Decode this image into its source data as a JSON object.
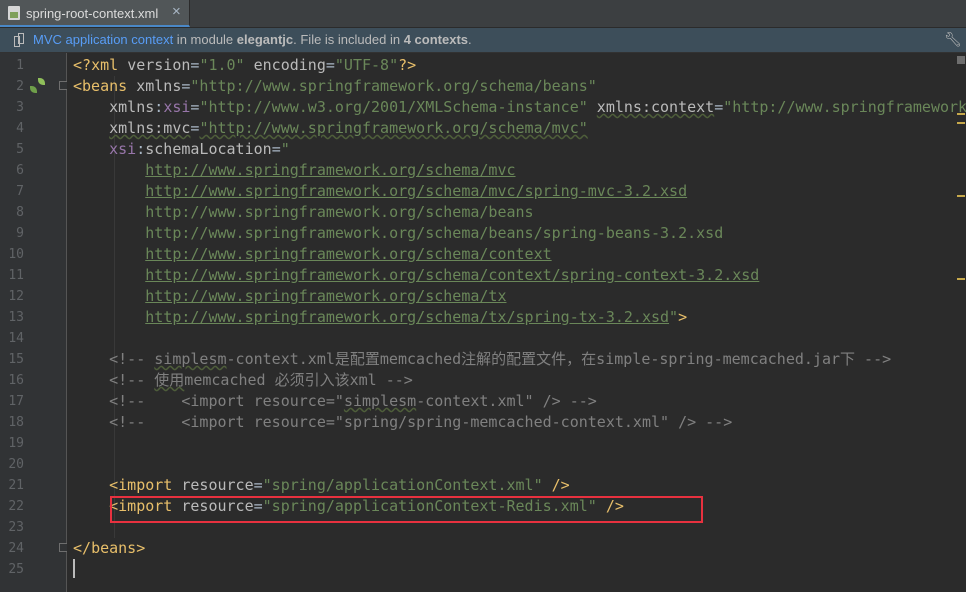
{
  "tab": {
    "filename": "spring-root-context.xml",
    "close": "×"
  },
  "infobar": {
    "link": "MVC application context",
    "t1": " in module ",
    "module": "elegantjc",
    "t2": ". File is included in ",
    "count": "4 contexts",
    "t3": "."
  },
  "line_numbers": [
    "1",
    "2",
    "3",
    "4",
    "5",
    "6",
    "7",
    "8",
    "9",
    "10",
    "11",
    "12",
    "13",
    "14",
    "15",
    "16",
    "17",
    "18",
    "19",
    "20",
    "21",
    "22",
    "23",
    "24",
    "25"
  ],
  "code": {
    "l1": {
      "a": "<?",
      "b": "xml ",
      "c": "version",
      "d": "=",
      "e": "\"1.0\"",
      "f": " ",
      "g": "encoding",
      "h": "=",
      "i": "\"UTF-8\"",
      "j": "?>"
    },
    "l2": {
      "a": "<",
      "b": "beans ",
      "c": "xmlns",
      "d": "=",
      "e": "\"http://www.springframework.org/schema/beans\""
    },
    "l3": {
      "indent": "    ",
      "a": "xmlns",
      "b": ":",
      "c": "xsi",
      "d": "=",
      "e": "\"http://www.w3.org/2001/XMLSchema-instance\"",
      "f": " ",
      "g": "xmlns:context",
      "h": "=",
      "i": "\"http://www.springframework.org/schema/context\""
    },
    "l4": {
      "indent": "    ",
      "a": "xmlns:mvc",
      "b": "=",
      "c": "\"http://www.springframework.org/schema/mvc\""
    },
    "l5": {
      "indent": "    ",
      "a": "xsi",
      "b": ":",
      "c": "schemaLocation",
      "d": "=",
      "e": "\""
    },
    "l6": {
      "indent": "        ",
      "a": "http://www.springframework.org/schema/mvc"
    },
    "l7": {
      "indent": "        ",
      "a": "http://www.springframework.org/schema/mvc/spring-mvc-3.2.xsd"
    },
    "l8": {
      "indent": "        ",
      "a": "http://www.springframework.org/schema/beans"
    },
    "l9": {
      "indent": "        ",
      "a": "http://www.springframework.org/schema/beans/spring-beans-3.2.xsd"
    },
    "l10": {
      "indent": "        ",
      "a": "http://www.springframework.org/schema/context"
    },
    "l11": {
      "indent": "        ",
      "a": "http://www.springframework.org/schema/context/spring-context-3.2.xsd"
    },
    "l12": {
      "indent": "        ",
      "a": "http://www.springframework.org/schema/tx"
    },
    "l13": {
      "indent": "        ",
      "a": "http://www.springframework.org/schema/tx/spring-tx-3.2.xsd",
      "b": "\"",
      "c": ">"
    },
    "l15": {
      "indent": "    ",
      "a": "<!-- ",
      "b": "simplesm",
      "c": "-context.xml是配置memcached注解的配置文件，在simple-spring-memcached.jar下 -->"
    },
    "l16": {
      "indent": "    ",
      "a": "<!-- ",
      "b": "使用",
      "c": "memcached 必须引入该xml -->"
    },
    "l17": {
      "indent": "    ",
      "a": "<!--    <import resource=\"",
      "b": "simplesm",
      "c": "-context.xml\" /> -->"
    },
    "l18": {
      "indent": "    ",
      "a": "<!--    <import resource=\"spring/spring-memcached-context.xml\" /> -->"
    },
    "l21": {
      "indent": "    ",
      "a": "<",
      "b": "import ",
      "c": "resource",
      "d": "=",
      "e": "\"spring/applicationContext.xml\"",
      "f": " ",
      "g": "/>"
    },
    "l22": {
      "indent": "    ",
      "a": "<",
      "b": "import ",
      "c": "resource",
      "d": "=",
      "e": "\"spring/applicationContext-Redis.xml\"",
      "f": " ",
      "g": "/>"
    },
    "l24": {
      "a": "</",
      "b": "beans",
      "c": ">"
    }
  }
}
